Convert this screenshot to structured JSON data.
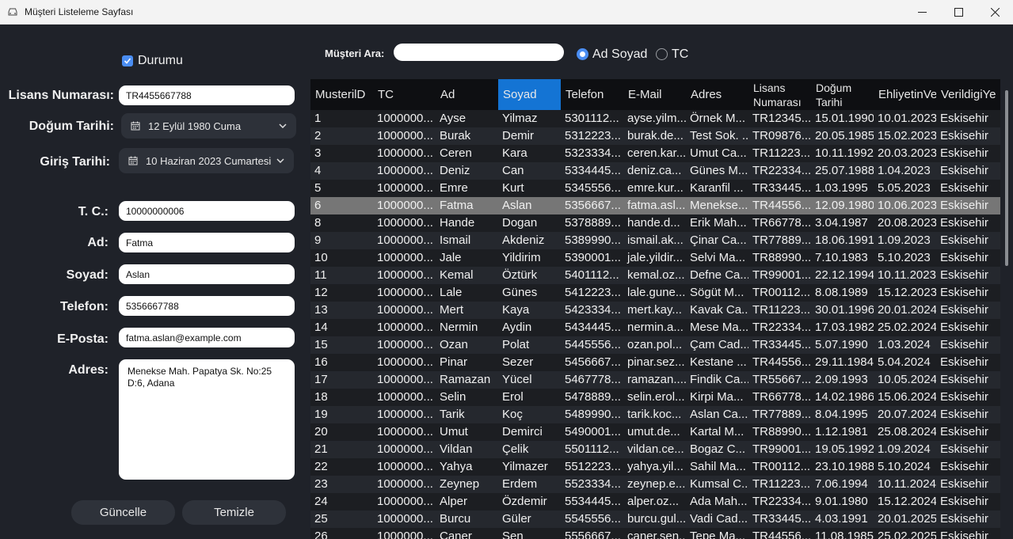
{
  "window": {
    "title": "Müşteri Listeleme Sayfası"
  },
  "form": {
    "status_label": "Durumu",
    "status_checked": true,
    "license_label": "Lisans Numarası:",
    "license_value": "TR4455667788",
    "birth_label": "Doğum Tarihi:",
    "birth_value": "12 Eylül 1980 Cuma",
    "entry_label": "Giriş Tarihi:",
    "entry_value": "10 Haziran 2023 Cumartesi",
    "tc_label": "T. C.:",
    "tc_value": "10000000006",
    "name_label": "Ad:",
    "name_value": "Fatma",
    "surname_label": "Soyad:",
    "surname_value": "Aslan",
    "phone_label": "Telefon:",
    "phone_value": "5356667788",
    "email_label": "E-Posta:",
    "email_value": "fatma.aslan@example.com",
    "address_label": "Adres:",
    "address_value": "Menekse Mah. Papatya Sk. No:25 D:6, Adana",
    "update_button": "Güncelle",
    "clear_button": "Temizle"
  },
  "search": {
    "label": "Müşteri Ara:",
    "value": "",
    "option_name": "Ad Soyad",
    "option_tc": "TC",
    "selected": "Ad Soyad"
  },
  "grid": {
    "columns": [
      {
        "label": "MusterilD",
        "selected": false
      },
      {
        "label": "TC",
        "selected": false
      },
      {
        "label": "Ad",
        "selected": false
      },
      {
        "label": "Soyad",
        "selected": true
      },
      {
        "label": "Telefon",
        "selected": false
      },
      {
        "label": "E-Mail",
        "selected": false
      },
      {
        "label": "Adres",
        "selected": false
      },
      {
        "label": "Lisans Numarası",
        "selected": false
      },
      {
        "label": "Doğum Tarihi",
        "selected": false
      },
      {
        "label": "EhliyetinVe",
        "selected": false
      },
      {
        "label": "VerildigiYe",
        "selected": false
      }
    ],
    "selected_row_index": 5,
    "rows": [
      [
        "1",
        "1000000...",
        "Ayse",
        "Yilmaz",
        "5301112...",
        "ayse.yilm...",
        "Örnek M...",
        "TR12345...",
        "15.01.1990",
        "10.01.2023",
        "Eskisehir"
      ],
      [
        "2",
        "1000000...",
        "Burak",
        "Demir",
        "5312223...",
        "burak.de...",
        "Test Sok. ...",
        "TR09876...",
        "20.05.1985",
        "15.02.2023",
        "Eskisehir"
      ],
      [
        "3",
        "1000000...",
        "Ceren",
        "Kara",
        "5323334...",
        "ceren.kar...",
        "Umut Ca...",
        "TR11223...",
        "10.11.1992",
        "20.03.2023",
        "Eskisehir"
      ],
      [
        "4",
        "1000000...",
        "Deniz",
        "Can",
        "5334445...",
        "deniz.ca...",
        "Günes M...",
        "TR22334...",
        "25.07.1988",
        "1.04.2023",
        "Eskisehir"
      ],
      [
        "5",
        "1000000...",
        "Emre",
        "Kurt",
        "5345556...",
        "emre.kur...",
        "Karanfil ...",
        "TR33445...",
        "1.03.1995",
        "5.05.2023",
        "Eskisehir"
      ],
      [
        "6",
        "1000000...",
        "Fatma",
        "Aslan",
        "5356667...",
        "fatma.asl...",
        "Menekse...",
        "TR44556...",
        "12.09.1980",
        "10.06.2023",
        "Eskisehir"
      ],
      [
        "8",
        "1000000...",
        "Hande",
        "Dogan",
        "5378889...",
        "hande.d...",
        "Erik Mah...",
        "TR66778...",
        "3.04.1987",
        "20.08.2023",
        "Eskisehir"
      ],
      [
        "9",
        "1000000...",
        "Ismail",
        "Akdeniz",
        "5389990...",
        "ismail.ak...",
        "Çinar Ca...",
        "TR77889...",
        "18.06.1991",
        "1.09.2023",
        "Eskisehir"
      ],
      [
        "10",
        "1000000...",
        "Jale",
        "Yildirim",
        "5390001...",
        "jale.yildir...",
        "Selvi Ma...",
        "TR88990...",
        "7.10.1983",
        "5.10.2023",
        "Eskisehir"
      ],
      [
        "11",
        "1000000...",
        "Kemal",
        "Öztürk",
        "5401112...",
        "kemal.oz...",
        "Defne Ca...",
        "TR99001...",
        "22.12.1994",
        "10.11.2023",
        "Eskisehir"
      ],
      [
        "12",
        "1000000...",
        "Lale",
        "Günes",
        "5412223...",
        "lale.gune...",
        "Sögüt M...",
        "TR00112...",
        "8.08.1989",
        "15.12.2023",
        "Eskisehir"
      ],
      [
        "13",
        "1000000...",
        "Mert",
        "Kaya",
        "5423334...",
        "mert.kay...",
        "Kavak Ca...",
        "TR11223...",
        "30.01.1996",
        "20.01.2024",
        "Eskisehir"
      ],
      [
        "14",
        "1000000...",
        "Nermin",
        "Aydin",
        "5434445...",
        "nermin.a...",
        "Mese Ma...",
        "TR22334...",
        "17.03.1982",
        "25.02.2024",
        "Eskisehir"
      ],
      [
        "15",
        "1000000...",
        "Ozan",
        "Polat",
        "5445556...",
        "ozan.pol...",
        "Çam Cad...",
        "TR33445...",
        "5.07.1990",
        "1.03.2024",
        "Eskisehir"
      ],
      [
        "16",
        "1000000...",
        "Pinar",
        "Sezer",
        "5456667...",
        "pinar.sez...",
        "Kestane ...",
        "TR44556...",
        "29.11.1984",
        "5.04.2024",
        "Eskisehir"
      ],
      [
        "17",
        "1000000...",
        "Ramazan",
        "Yücel",
        "5467778...",
        "ramazan....",
        "Findik Ca...",
        "TR55667...",
        "2.09.1993",
        "10.05.2024",
        "Eskisehir"
      ],
      [
        "18",
        "1000000...",
        "Selin",
        "Erol",
        "5478889...",
        "selin.erol...",
        "Kirpi Ma...",
        "TR66778...",
        "14.02.1986",
        "15.06.2024",
        "Eskisehir"
      ],
      [
        "19",
        "1000000...",
        "Tarik",
        "Koç",
        "5489990...",
        "tarik.koc...",
        "Aslan Ca...",
        "TR77889...",
        "8.04.1995",
        "20.07.2024",
        "Eskisehir"
      ],
      [
        "20",
        "1000000...",
        "Umut",
        "Demirci",
        "5490001...",
        "umut.de...",
        "Kartal M...",
        "TR88990...",
        "1.12.1981",
        "25.08.2024",
        "Eskisehir"
      ],
      [
        "21",
        "1000000...",
        "Vildan",
        "Çelik",
        "5501112...",
        "vildan.ce...",
        "Bogaz C...",
        "TR99001...",
        "19.05.1992",
        "1.09.2024",
        "Eskisehir"
      ],
      [
        "22",
        "1000000...",
        "Yahya",
        "Yilmazer",
        "5512223...",
        "yahya.yil...",
        "Sahil Ma...",
        "TR00112...",
        "23.10.1988",
        "5.10.2024",
        "Eskisehir"
      ],
      [
        "23",
        "1000000...",
        "Zeynep",
        "Erdem",
        "5523334...",
        "zeynep.e...",
        "Kumsal C...",
        "TR11223...",
        "7.06.1994",
        "10.11.2024",
        "Eskisehir"
      ],
      [
        "24",
        "1000000...",
        "Alper",
        "Özdemir",
        "5534445...",
        "alper.oz...",
        "Ada Mah...",
        "TR22334...",
        "9.01.1980",
        "15.12.2024",
        "Eskisehir"
      ],
      [
        "25",
        "1000000...",
        "Burcu",
        "Güler",
        "5545556...",
        "burcu.gul...",
        "Vadi Cad...",
        "TR33445...",
        "4.03.1991",
        "20.01.2025",
        "Eskisehir"
      ],
      [
        "26",
        "1000000...",
        "Caner",
        "Sen",
        "5556667...",
        "caner.sen...",
        "Tepe Ma...",
        "TR44556...",
        "11.08.1985",
        "25.02.2025",
        "Eskisehir"
      ]
    ]
  },
  "colors": {
    "background": "#1f2229",
    "row_dark": "#1c1e22",
    "row_alt": "#25282e",
    "row_selected": "#767676",
    "header_bg": "#0e0f12",
    "header_selected": "#1474d4",
    "accent": "#4a8df2"
  }
}
